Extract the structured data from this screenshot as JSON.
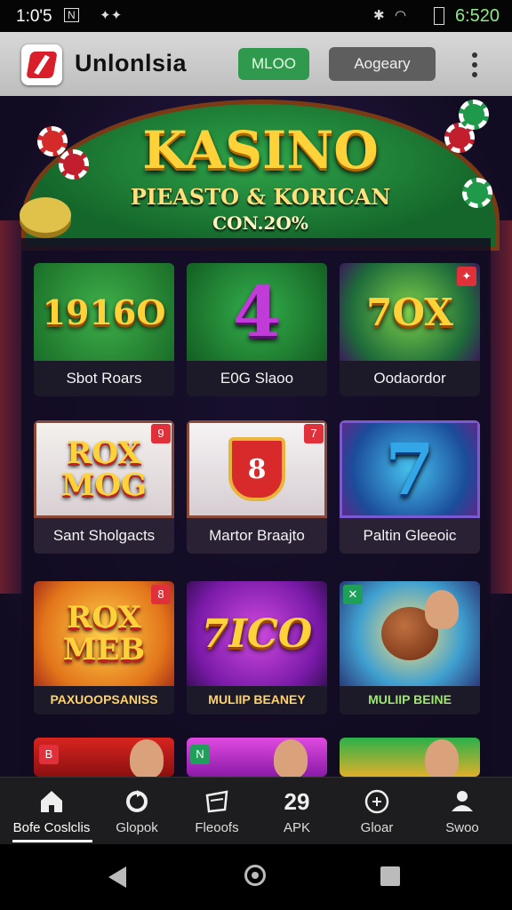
{
  "status_bar": {
    "time": "1:0'5",
    "clock_right": "6:520"
  },
  "app_bar": {
    "title": "Unlonlsia",
    "button_green": "MLOO",
    "button_gray": "Aogeary"
  },
  "banner": {
    "title": "KASINO",
    "subtitle": "PIEASTO & KORICAN",
    "line3": "CON.2O%"
  },
  "games": [
    {
      "label": "Sbot Roars",
      "art_text": "1916O"
    },
    {
      "label": "E0G Slaoo",
      "art_text": "4"
    },
    {
      "label": "Oodaordor",
      "art_text": "7OX"
    },
    {
      "label": "Sant Sholgacts",
      "art_text": "ROX MOG"
    },
    {
      "label": "Martor Braajto",
      "art_text": "8"
    },
    {
      "label": "Paltin Gleeoic",
      "art_text": "7"
    },
    {
      "label": "PAXUOOPSANISS",
      "art_text": "ROX MEB"
    },
    {
      "label": "MULIIP BEANEY",
      "art_text": "7ICO"
    },
    {
      "label": "MULIIP BEINE",
      "art_text": ""
    }
  ],
  "bottom_nav": [
    {
      "label": "Bofe Coslclis",
      "icon": "home-icon"
    },
    {
      "label": "Glopok",
      "icon": "refresh-icon"
    },
    {
      "label": "Fleoofs",
      "icon": "ticket-icon"
    },
    {
      "label": "APK",
      "icon": "apk-icon",
      "glyph": "29"
    },
    {
      "label": "Gloar",
      "icon": "chat-icon"
    },
    {
      "label": "Swoo",
      "icon": "profile-icon"
    }
  ]
}
